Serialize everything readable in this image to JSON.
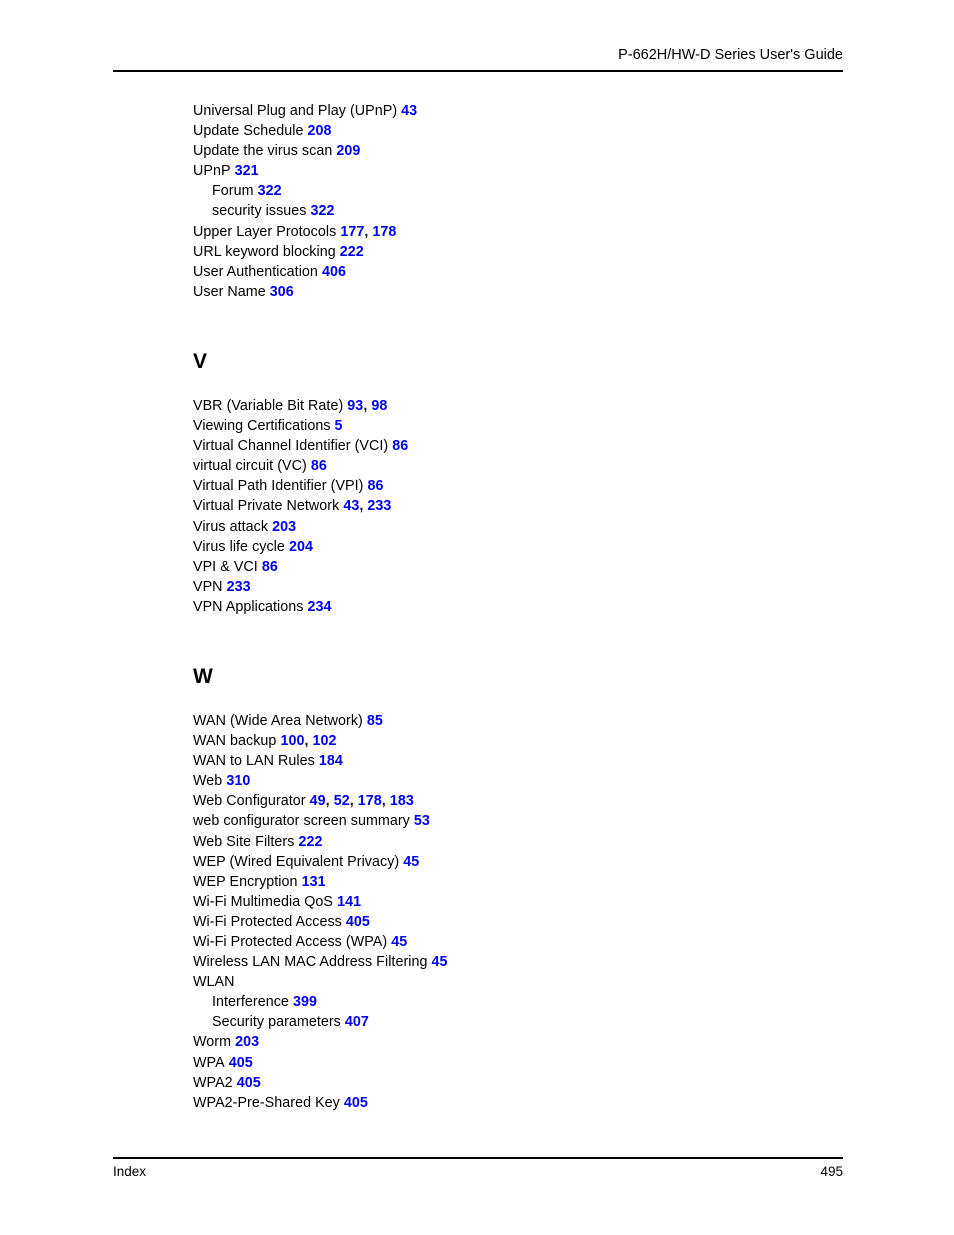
{
  "header": {
    "title": "P-662H/HW-D Series User's Guide"
  },
  "footer": {
    "left_label": "Index",
    "page_number": "495"
  },
  "colors": {
    "page_number_link": "#0000ee",
    "text": "#000000",
    "rule": "#000000"
  },
  "index": {
    "blocks": [
      {
        "letter": null,
        "entries": [
          {
            "term": "Universal Plug and Play (UPnP)",
            "pages": [
              "43"
            ],
            "level": 0
          },
          {
            "term": "Update Schedule",
            "pages": [
              "208"
            ],
            "level": 0
          },
          {
            "term": "Update the virus scan",
            "pages": [
              "209"
            ],
            "level": 0
          },
          {
            "term": "UPnP",
            "pages": [
              "321"
            ],
            "level": 0
          },
          {
            "term": "Forum",
            "pages": [
              "322"
            ],
            "level": 1
          },
          {
            "term": "security issues",
            "pages": [
              "322"
            ],
            "level": 1
          },
          {
            "term": "Upper Layer Protocols",
            "pages": [
              "177",
              "178"
            ],
            "level": 0
          },
          {
            "term": "URL keyword blocking",
            "pages": [
              "222"
            ],
            "level": 0
          },
          {
            "term": "User Authentication",
            "pages": [
              "406"
            ],
            "level": 0
          },
          {
            "term": "User Name",
            "pages": [
              "306"
            ],
            "level": 0
          }
        ]
      },
      {
        "letter": "V",
        "entries": [
          {
            "term": "VBR (Variable Bit Rate)",
            "pages": [
              "93",
              "98"
            ],
            "level": 0
          },
          {
            "term": "Viewing Certifications",
            "pages": [
              "5"
            ],
            "level": 0
          },
          {
            "term": "Virtual Channel Identifier (VCI)",
            "pages": [
              "86"
            ],
            "level": 0
          },
          {
            "term": "virtual circuit (VC)",
            "pages": [
              "86"
            ],
            "level": 0
          },
          {
            "term": "Virtual Path Identifier (VPI)",
            "pages": [
              "86"
            ],
            "level": 0
          },
          {
            "term": "Virtual Private Network",
            "pages": [
              "43",
              "233"
            ],
            "level": 0
          },
          {
            "term": "Virus attack",
            "pages": [
              "203"
            ],
            "level": 0
          },
          {
            "term": "Virus life cycle",
            "pages": [
              "204"
            ],
            "level": 0
          },
          {
            "term": "VPI & VCI",
            "pages": [
              "86"
            ],
            "level": 0
          },
          {
            "term": "VPN",
            "pages": [
              "233"
            ],
            "level": 0
          },
          {
            "term": "VPN Applications",
            "pages": [
              "234"
            ],
            "level": 0
          }
        ]
      },
      {
        "letter": "W",
        "entries": [
          {
            "term": "WAN (Wide Area Network)",
            "pages": [
              "85"
            ],
            "level": 0
          },
          {
            "term": "WAN backup",
            "pages": [
              "100",
              "102"
            ],
            "level": 0
          },
          {
            "term": "WAN to LAN Rules",
            "pages": [
              "184"
            ],
            "level": 0
          },
          {
            "term": "Web",
            "pages": [
              "310"
            ],
            "level": 0
          },
          {
            "term": "Web Configurator",
            "pages": [
              "49",
              "52",
              "178",
              "183"
            ],
            "level": 0
          },
          {
            "term": "web configurator screen summary",
            "pages": [
              "53"
            ],
            "level": 0
          },
          {
            "term": "Web Site Filters",
            "pages": [
              "222"
            ],
            "level": 0
          },
          {
            "term": "WEP (Wired Equivalent Privacy)",
            "pages": [
              "45"
            ],
            "level": 0
          },
          {
            "term": "WEP Encryption",
            "pages": [
              "131"
            ],
            "level": 0
          },
          {
            "term": "Wi-Fi Multimedia QoS",
            "pages": [
              "141"
            ],
            "level": 0
          },
          {
            "term": "Wi-Fi Protected Access",
            "pages": [
              "405"
            ],
            "level": 0
          },
          {
            "term": "Wi-Fi Protected Access (WPA)",
            "pages": [
              "45"
            ],
            "level": 0
          },
          {
            "term": "Wireless LAN MAC Address Filtering",
            "pages": [
              "45"
            ],
            "level": 0
          },
          {
            "term": "WLAN",
            "pages": [],
            "level": 0
          },
          {
            "term": "Interference",
            "pages": [
              "399"
            ],
            "level": 1
          },
          {
            "term": "Security parameters",
            "pages": [
              "407"
            ],
            "level": 1
          },
          {
            "term": "Worm",
            "pages": [
              "203"
            ],
            "level": 0
          },
          {
            "term": "WPA",
            "pages": [
              "405"
            ],
            "level": 0
          },
          {
            "term": "WPA2",
            "pages": [
              "405"
            ],
            "level": 0
          },
          {
            "term": "WPA2-Pre-Shared Key",
            "pages": [
              "405"
            ],
            "level": 0
          }
        ]
      }
    ]
  }
}
